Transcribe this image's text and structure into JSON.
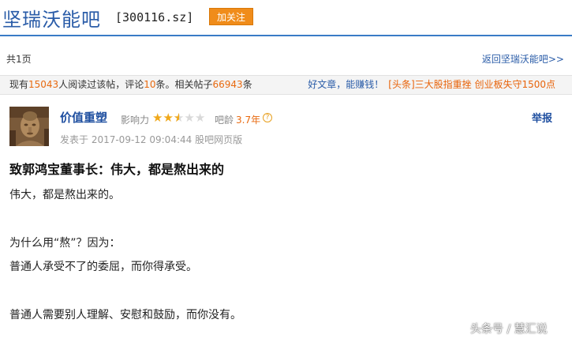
{
  "header": {
    "bar_title": "坚瑞沃能吧",
    "stock_code": "[300116.sz]",
    "follow_label": "加关注"
  },
  "pager": {
    "total_pages": "共1页",
    "back_link": "返回坚瑞沃能吧>>"
  },
  "info_bar": {
    "prefix": "现有",
    "readers": "15043",
    "readers_suffix": "人阅读过该帖，评论",
    "comments": "10",
    "comments_suffix": "条。相关帖子",
    "related": "66943",
    "related_suffix": "条",
    "good_article": "好文章，能赚钱！",
    "headline": "[头条]三大股指重挫 创业板失守1500点"
  },
  "post": {
    "author": "价值重塑",
    "influence_label": "影响力",
    "influence_rating": 2.5,
    "influence_max": 5,
    "age_label": "吧龄",
    "age_value": "3.7年",
    "report": "举报",
    "time": "发表于 2017-09-12 09:04:44 股吧网页版",
    "title": "致郭鸿宝董事长：伟大，都是熬出来的",
    "paragraphs": [
      "伟大，都是熬出来的。",
      "为什么用“熬”？因为：",
      "普通人承受不了的委屈，而你得承受。",
      "普通人需要别人理解、安慰和鼓励，而你没有。"
    ]
  },
  "watermark": "头条号 / 慧汇说",
  "colors": {
    "accent_blue": "#2a5ca8",
    "accent_orange": "#e86a10",
    "button_orange": "#f08c1a",
    "star_gold": "#f0a81a"
  }
}
